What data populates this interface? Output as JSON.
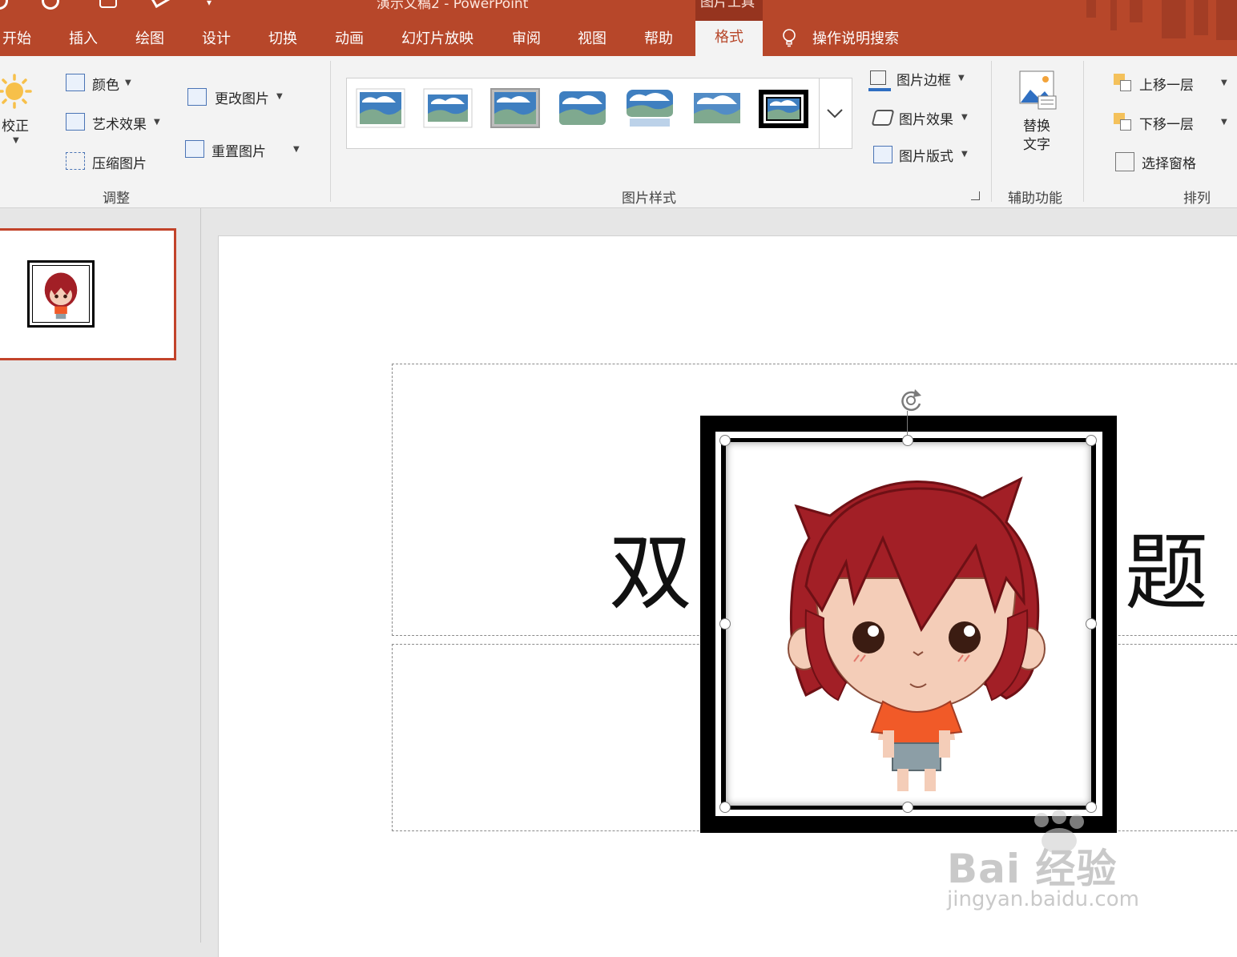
{
  "window": {
    "title": "演示文稿2 - PowerPoint",
    "context_group": "图片工具"
  },
  "tabs": [
    "开始",
    "插入",
    "绘图",
    "设计",
    "切换",
    "动画",
    "幻灯片放映",
    "审阅",
    "视图",
    "帮助"
  ],
  "active_tab": "格式",
  "search": {
    "label": "操作说明搜索"
  },
  "ribbon": {
    "adjust": {
      "group_label": "调整",
      "correct": "校正",
      "color": "颜色",
      "artistic": "艺术效果",
      "compress": "压缩图片",
      "change": "更改图片",
      "reset": "重置图片"
    },
    "styles": {
      "group_label": "图片样式",
      "border": "图片边框",
      "effects": "图片效果",
      "layout": "图片版式"
    },
    "accessibility": {
      "group_label": "辅助功能",
      "alt_text_line1": "替换",
      "alt_text_line2": "文字"
    },
    "arrange": {
      "group_label": "排列",
      "bring_forward": "上移一层",
      "send_backward": "下移一层",
      "selection_pane": "选择窗格"
    }
  },
  "slide": {
    "title_left": "双",
    "title_right": "题"
  },
  "watermark": {
    "line1": "Bai 经验",
    "line2": "jingyan.baidu.com"
  },
  "colors": {
    "accent": "#b7472a",
    "ribbon_bg": "#f3f3f3",
    "hair": "#a21f26",
    "skin": "#f4cdb8",
    "shirt": "#f15a28",
    "shorts": "#8c9ea6"
  }
}
